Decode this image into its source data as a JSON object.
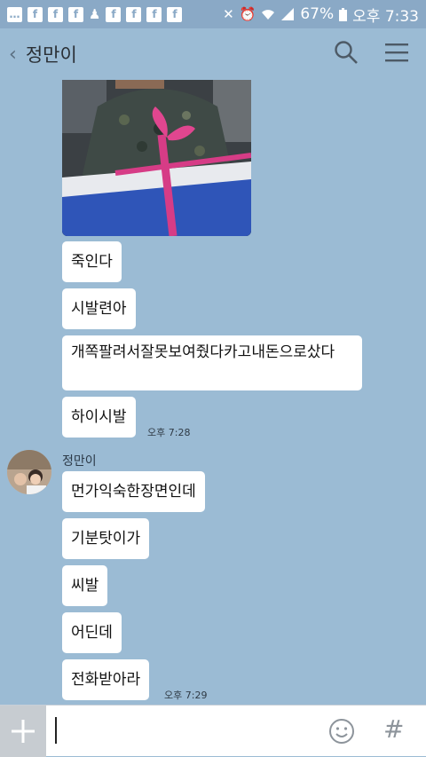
{
  "status_bar": {
    "battery": "67%",
    "time": "오후 7:33",
    "notification_icons": [
      "chat-icon",
      "facebook-icon",
      "facebook-icon",
      "facebook-icon",
      "person-icon",
      "facebook-icon",
      "facebook-icon",
      "facebook-icon",
      "facebook-icon"
    ],
    "notif_letter": "f"
  },
  "header": {
    "back_symbol": "‹",
    "title": "정만이"
  },
  "messages_group1": [
    "죽인다",
    "시발련아",
    "개쪽팔려서잘못보여줬다카고내돈으로샀다",
    "하이시발"
  ],
  "time1": "오후 7:28",
  "sender": "정만이",
  "messages_group2": [
    "먼가익숙한장면인데",
    "기분탓이가",
    "씨발",
    "어딘데",
    "전화받아라"
  ],
  "time2": "오후 7:29",
  "input": {
    "placeholder": "",
    "plus_symbol": "+",
    "hash_symbol": "#"
  },
  "colors": {
    "chat_bg": "#9bbbd4",
    "status_bg": "#8aa9c6",
    "bubble": "#ffffff"
  }
}
